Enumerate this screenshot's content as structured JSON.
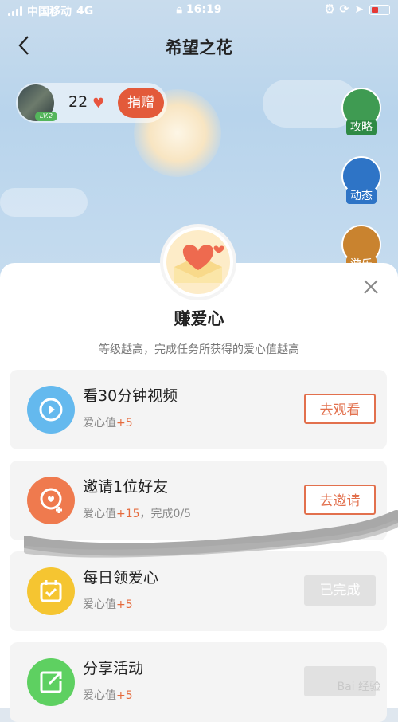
{
  "status_bar": {
    "carrier": "中国移动",
    "network": "4G",
    "time": "16:19"
  },
  "nav": {
    "title": "希望之花",
    "back_icon": "chevron-left-icon"
  },
  "user": {
    "level": "LV.2",
    "hearts": "22",
    "donate_label": "捐赠"
  },
  "side_buttons": [
    {
      "label": "攻略",
      "icon": "guide-icon",
      "color": "#3f9b52"
    },
    {
      "label": "动态",
      "icon": "news-icon",
      "color": "#2e74c6"
    },
    {
      "label": "游乐园",
      "icon": "playground-icon",
      "color": "#c9832f"
    }
  ],
  "sheet": {
    "title": "赚爱心",
    "subtitle": "等级越高，完成任务所获得的爱心值越高",
    "close_icon": "close-icon"
  },
  "tasks": [
    {
      "name": "看30分钟视频",
      "meta_prefix": "爱心值",
      "meta_plus": "+5",
      "meta_suffix": "",
      "button": "去观看",
      "done": false,
      "icon": "play-icon",
      "color": "#64b9ee"
    },
    {
      "name": "邀请1位好友",
      "meta_prefix": "爱心值",
      "meta_plus": "+15",
      "meta_suffix": "，完成0/5",
      "button": "去邀请",
      "done": false,
      "icon": "invite-friend-icon",
      "color": "#ef7a4e"
    },
    {
      "name": "每日领爱心",
      "meta_prefix": "爱心值",
      "meta_plus": "+5",
      "meta_suffix": "",
      "button": "已完成",
      "done": true,
      "icon": "calendar-check-icon",
      "color": "#f5c531"
    },
    {
      "name": "分享活动",
      "meta_prefix": "爱心值",
      "meta_plus": "+5",
      "meta_suffix": "",
      "button": "",
      "done": true,
      "icon": "share-icon",
      "color": "#5ed061"
    }
  ],
  "watermark": "Bai 经验"
}
